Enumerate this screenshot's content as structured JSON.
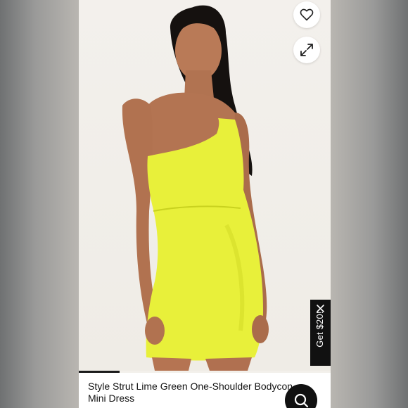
{
  "product": {
    "title": "Style Strut Lime Green One-Shoulder Bodycon Mini Dress"
  },
  "promo": {
    "label": "Get $20!",
    "close_icon": "close-icon"
  },
  "icons": {
    "favorite": "heart-icon",
    "expand": "expand-icon",
    "search": "search-icon"
  },
  "colors": {
    "dress": "#e8f03a",
    "promo_bg": "#111111",
    "fab_bg": "#111111",
    "backdrop": "#f3f0eb"
  }
}
